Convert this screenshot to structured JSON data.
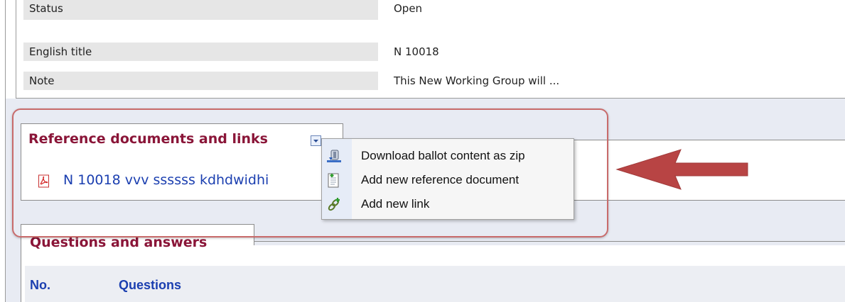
{
  "details": {
    "rows": [
      {
        "label": "Status",
        "value": "Open"
      },
      {
        "label": "English title",
        "value": "N 10018"
      },
      {
        "label": "Note",
        "value": "This New Working Group will ..."
      }
    ]
  },
  "reference_section": {
    "title": "Reference documents and links",
    "menu_toggle_icon": "dropdown-arrow-icon",
    "documents": [
      {
        "icon": "pdf-icon",
        "label": "N 10018 vvv ssssss kdhdwidhi"
      }
    ]
  },
  "context_menu": {
    "items": [
      {
        "icon": "zip-download-icon",
        "label": "Download ballot content as zip"
      },
      {
        "icon": "add-document-icon",
        "label": "Add new reference document"
      },
      {
        "icon": "add-link-icon",
        "label": "Add new link"
      }
    ]
  },
  "questions_section": {
    "title": "Questions and answers",
    "columns": [
      "No.",
      "Questions"
    ]
  },
  "annotation": {
    "highlight_color": "#c86b6b",
    "arrow_color": "#b84444",
    "arrow_icon": "left-arrow-icon"
  },
  "colors": {
    "section_title": "#8a1538",
    "link": "#1b3fb0",
    "label_bg": "#e6e6e6",
    "area_bg": "#e8ebf3"
  }
}
